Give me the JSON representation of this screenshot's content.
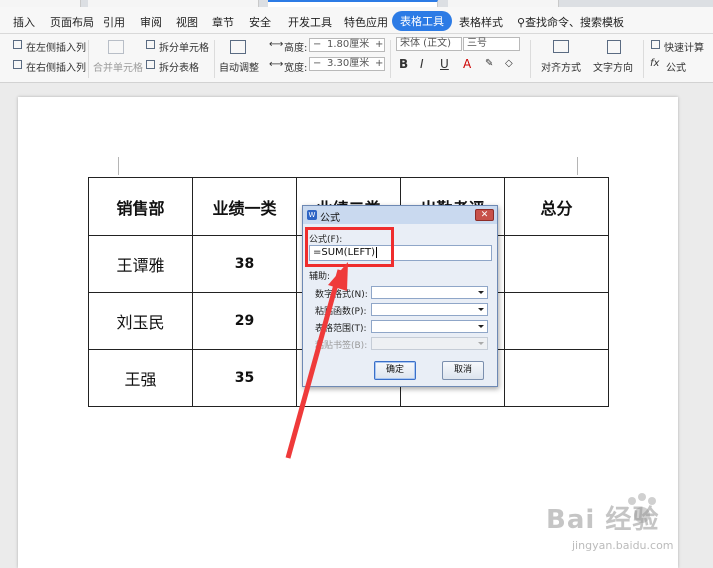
{
  "ribbon": {
    "tabs": [
      "插入",
      "页面布局",
      "引用",
      "审阅",
      "视图",
      "章节",
      "安全",
      "开发工具",
      "特色应用",
      "表格工具",
      "表格样式"
    ],
    "active_tab": "表格工具",
    "search": "查找命令、搜索模板",
    "insert_left": "在左侧插入列",
    "insert_right": "在右侧插入列",
    "merge_cells": "合并单元格",
    "split_cells": "拆分单元格",
    "split_table": "拆分表格",
    "auto_adjust": "自动调整",
    "height_label": "高度:",
    "height_value": "1.80厘米",
    "width_label": "宽度:",
    "width_value": "3.30厘米",
    "font_name": "宋体 (正文)",
    "font_size": "三号",
    "bold": "B",
    "italic": "I",
    "underline": "U",
    "font_color": "A",
    "align": "对齐方式",
    "text_direction": "文字方向",
    "quick_calc": "快速计算",
    "formula": "公式",
    "fx": "fx",
    "minus": "−",
    "plus": "+"
  },
  "table": {
    "rows": [
      [
        "销售部",
        "业绩一类",
        "业绩二类",
        "出勤考评",
        "总分"
      ],
      [
        "王谭雅",
        "38",
        "",
        "",
        ""
      ],
      [
        "刘玉民",
        "29",
        "",
        "",
        ""
      ],
      [
        "王强",
        "35",
        "",
        "",
        ""
      ]
    ]
  },
  "dialog": {
    "title": "公式",
    "logo": "W",
    "close": "✕",
    "formula_label": "公式(F):",
    "formula_value": "=SUM(LEFT)",
    "helper_label": "辅助:",
    "number_format_label": "数字格式(N):",
    "paste_function_label": "粘贴函数(P):",
    "table_range_label": "表格范围(T):",
    "paste_bookmark_label": "粘贴书签(B):",
    "ok": "确定",
    "cancel": "取消"
  },
  "watermark": {
    "brand": "Bai 经验",
    "url": "jingyan.baidu.com"
  }
}
